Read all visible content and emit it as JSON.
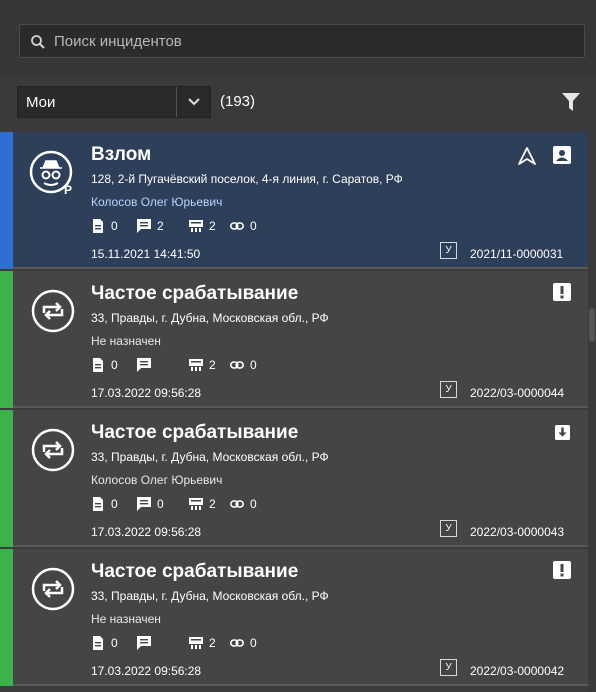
{
  "search": {
    "placeholder": "Поиск инцидентов"
  },
  "filter": {
    "selected": "Мои",
    "count": "(193)"
  },
  "colors": {
    "selected_bg": "#2d3f59",
    "card_bg": "#454545",
    "stripe_blue": "#2f6fd3",
    "stripe_green": "#3cb34a"
  },
  "incidents": [
    {
      "title": "Взлом",
      "address": "128, 2-й Пугачёвский поселок, 4-я линия, г. Саратов, РФ",
      "assignee": "Колосов Олег Юрьевич",
      "docs": "0",
      "comments": "2",
      "devices": "2",
      "links": "0",
      "datetime": "15.11.2021 14:41:50",
      "ybadge": "У",
      "number": "2021/11-0000031",
      "icon": "intruder-icon",
      "actions": [
        "navigate-icon",
        "person-card-icon"
      ]
    },
    {
      "title": "Частое срабатывание",
      "address": "33, Правды, г. Дубна, Московская обл., РФ",
      "assignee": "Не назначен",
      "docs": "0",
      "comments": "",
      "devices": "2",
      "links": "0",
      "datetime": "17.03.2022 09:56:28",
      "ybadge": "У",
      "number": "2022/03-0000044",
      "icon": "repeat-icon",
      "actions": [
        "alert-icon"
      ]
    },
    {
      "title": "Частое срабатывание",
      "address": "33, Правды, г. Дубна, Московская обл., РФ",
      "assignee": "Колосов Олег Юрьевич",
      "docs": "0",
      "comments": "0",
      "devices": "2",
      "links": "0",
      "datetime": "17.03.2022 09:56:28",
      "ybadge": "У",
      "number": "2022/03-0000043",
      "icon": "repeat-icon",
      "actions": [
        "download-icon"
      ]
    },
    {
      "title": "Частое срабатывание",
      "address": "33, Правды, г. Дубна, Московская обл., РФ",
      "assignee": "Не назначен",
      "docs": "0",
      "comments": "",
      "devices": "2",
      "links": "0",
      "datetime": "17.03.2022 09:56:28",
      "ybadge": "У",
      "number": "2022/03-0000042",
      "icon": "repeat-icon",
      "actions": [
        "alert-icon"
      ]
    }
  ]
}
